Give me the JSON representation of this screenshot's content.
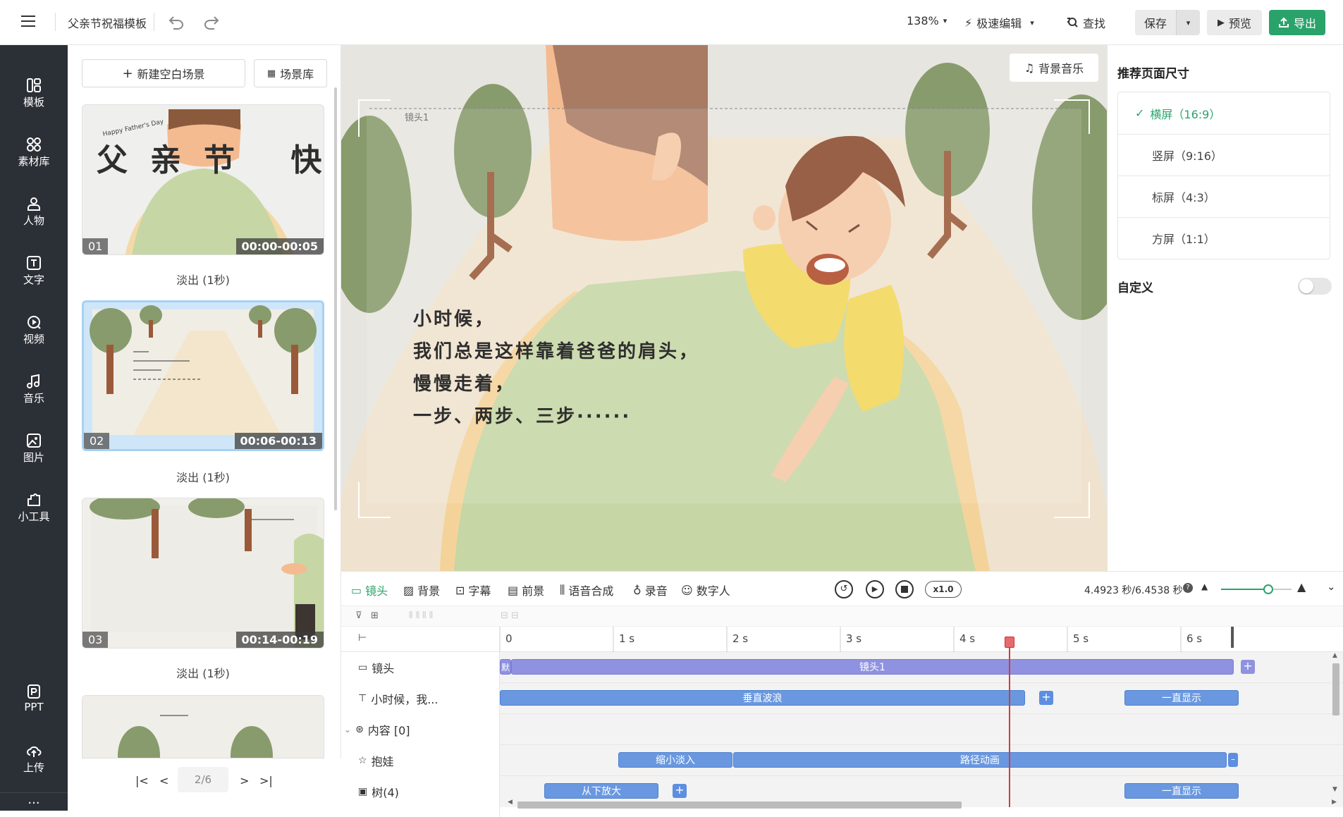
{
  "header": {
    "title": "父亲节祝福模板",
    "zoom": "138%",
    "edit_mode": "极速编辑",
    "find": "查找",
    "save": "保存",
    "preview": "预览",
    "export": "导出"
  },
  "rail": {
    "items": [
      {
        "label": "模板",
        "icon": "template-icon"
      },
      {
        "label": "素材库",
        "icon": "material-icon"
      },
      {
        "label": "人物",
        "icon": "person-icon"
      },
      {
        "label": "文字",
        "icon": "text-icon"
      },
      {
        "label": "视频",
        "icon": "video-icon"
      },
      {
        "label": "音乐",
        "icon": "music-icon"
      },
      {
        "label": "图片",
        "icon": "image-icon"
      },
      {
        "label": "小工具",
        "icon": "tool-icon"
      }
    ],
    "ppt": "PPT",
    "upload": "上传",
    "more": "···"
  },
  "scenes": {
    "new_blank": "新建空白场景",
    "library": "场景库",
    "cards": [
      {
        "num": "01",
        "time": "00:00-00:05",
        "transition": "淡出 (1秒)",
        "title_text": "父亲节 快乐",
        "subtitle": "Happy Father's Day"
      },
      {
        "num": "02",
        "time": "00:06-00:13",
        "transition": "淡出 (1秒)"
      },
      {
        "num": "03",
        "time": "00:14-00:19",
        "transition": "淡出 (1秒)"
      }
    ],
    "pagination": "2/6"
  },
  "canvas": {
    "bg_music": "背景音乐",
    "shot_label": "镜头1",
    "lines": [
      "小时候，",
      "我们总是这样靠着爸爸的肩头，",
      "慢慢走着，",
      "一步、两步、三步······"
    ]
  },
  "right_panel": {
    "title": "推荐页面尺寸",
    "options": [
      {
        "label": "横屏（16:9）",
        "selected": true
      },
      {
        "label": "竖屏（9:16）",
        "selected": false
      },
      {
        "label": "标屏（4:3）",
        "selected": false
      },
      {
        "label": "方屏（1:1）",
        "selected": false
      }
    ],
    "custom": "自定义",
    "custom_on": false
  },
  "timeline": {
    "tabs": [
      "镜头",
      "背景",
      "字幕",
      "前景",
      "语音合成",
      "录音",
      "数字人"
    ],
    "speed": "x1.0",
    "time": "4.4923 秒/6.4538 秒",
    "ruler": [
      "0",
      "1 s",
      "2 s",
      "3 s",
      "4 s",
      "5 s",
      "6 s"
    ],
    "playhead_seconds": 4.4923,
    "total_seconds": 6.4538,
    "tracks": [
      {
        "label": "镜头",
        "icon": "camera-icon"
      },
      {
        "label": "小时候，我...",
        "icon": "text-icon"
      },
      {
        "label": "内容 [0]",
        "icon": "group-icon"
      },
      {
        "label": "抱娃",
        "icon": "star-icon"
      },
      {
        "label": "树(4)",
        "icon": "image-icon"
      }
    ],
    "bars": {
      "shot": "镜头1",
      "shot_default": "默",
      "text_anim": "垂直波浪",
      "text_always": "一直显示",
      "baby_in": "缩小淡入",
      "baby_path": "路径动画",
      "tree_in": "从下放大",
      "tree_always": "一直显示"
    }
  },
  "colors": {
    "accent_green": "#2aa36b",
    "rail_bg": "#2b2f36",
    "bar_blue": "#6a98e0",
    "shot_purple": "#8f92e0",
    "playhead": "#d63a3a"
  }
}
